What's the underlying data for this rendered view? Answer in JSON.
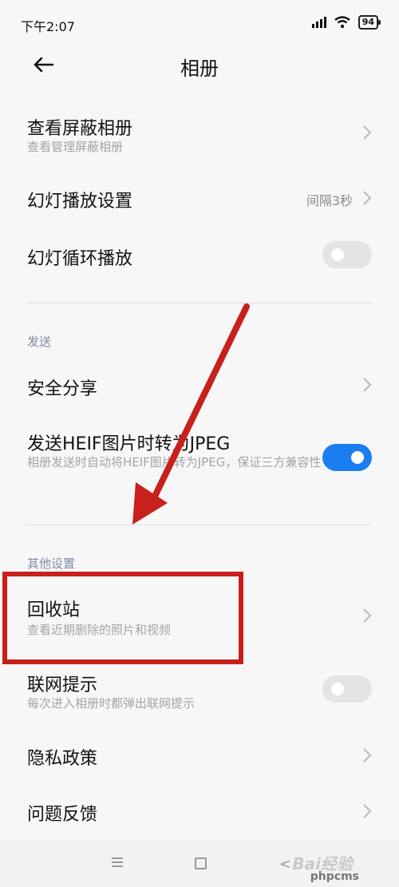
{
  "status": {
    "time": "下午2:07",
    "battery": "94"
  },
  "header": {
    "title": "相册"
  },
  "items": {
    "hidden_album": {
      "label": "查看屏蔽相册",
      "sub": "查看管理屏蔽相册"
    },
    "slideshow_settings": {
      "label": "幻灯播放设置",
      "value": "间隔3秒"
    },
    "slideshow_loop": {
      "label": "幻灯循环播放",
      "toggle": false
    },
    "secure_share": {
      "label": "安全分享"
    },
    "heif_convert": {
      "label": "发送HEIF图片时转为JPEG",
      "sub": "相册发送时自动将HEIF图片转为JPEG，保证三方兼容性",
      "toggle": true
    },
    "recycle_bin": {
      "label": "回收站",
      "sub": "查看近期删除的照片和视频"
    },
    "network_prompt": {
      "label": "联网提示",
      "sub": "每次进入相册时都弹出联网提示",
      "toggle": false
    },
    "privacy_policy": {
      "label": "隐私政策"
    },
    "feedback": {
      "label": "问题反馈"
    }
  },
  "sections": {
    "send": "发送",
    "other": "其他设置"
  },
  "watermark": {
    "baidu": "Bai经验",
    "site": "phpcms"
  },
  "colors": {
    "accent": "#1a7ef0",
    "annotation": "#c8201c",
    "section_text": "#7e8aa5"
  },
  "icons": [
    "back-arrow-icon",
    "chevron-right-icon",
    "wifi-icon",
    "signal-icon",
    "battery-icon",
    "menu-icon",
    "home-icon",
    "nav-back-icon"
  ]
}
